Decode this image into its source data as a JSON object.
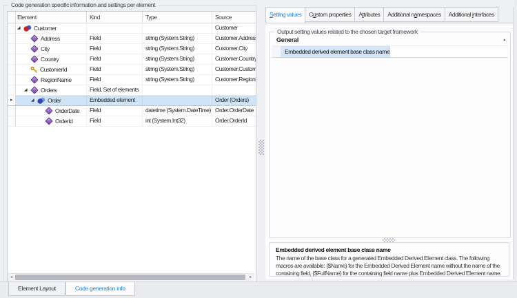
{
  "colors": {
    "accent_blue": "#1b87da",
    "selection_blue": "#cfe4f7",
    "window_background": "#eef0f3",
    "field_icon_purple": "#8952b5",
    "key_icon_gold": "#d4a500",
    "entity_icon_red": "#cf2020",
    "entity_icon_blue": "#3a57c4"
  },
  "icons": {
    "expander_expanded": "triangle-lower-right",
    "row_marker": "small-right-triangle",
    "category_collapse": "small-up-triangle",
    "scroll_left_arrow": "left-triangle",
    "scroll_right_arrow": "right-triangle",
    "field_icon": "purple-diamond",
    "primary_key_icon": "gold-key",
    "entity_icon": "red-blue-spheres",
    "embedded_element_icon": "blue-spheres"
  },
  "left_panel": {
    "group_title": "Code generation specific information and settings per element",
    "grid": {
      "columns": {
        "element": "Element",
        "kind": "Kind",
        "type": "Type",
        "source": "Source"
      },
      "rows": [
        {
          "label": "Customer",
          "kind": "",
          "type": "",
          "source": "Customer"
        },
        {
          "label": "Address",
          "kind": "Field",
          "type": "string (System.String)",
          "source": "Customer.Address"
        },
        {
          "label": "City",
          "kind": "Field",
          "type": "string (System.String)",
          "source": "Customer.City"
        },
        {
          "label": "Country",
          "kind": "Field",
          "type": "string (System.String)",
          "source": "Customer.Country"
        },
        {
          "label": "CustomerId",
          "kind": "Field",
          "type": "string (System.String)",
          "source": "Customer.CustomerId"
        },
        {
          "label": "RegionName",
          "kind": "Field",
          "type": "string (System.String)",
          "source": "Customer.RegionName"
        },
        {
          "label": "Orders",
          "kind": "Field, Set of elements",
          "type": "",
          "source": ""
        },
        {
          "label": "Order",
          "kind": "Embedded element",
          "type": "",
          "source": "Order (Orders)"
        },
        {
          "label": "OrderDate",
          "kind": "Field",
          "type": "datetime (System.DateTime)",
          "source": "Order.OrderDate"
        },
        {
          "label": "OrderId",
          "kind": "Field",
          "type": "int (System.Int32)",
          "source": "Order.OrderId"
        }
      ]
    }
  },
  "right_panel": {
    "tabs": [
      {
        "label": "Setting values",
        "underline": 0,
        "active": true
      },
      {
        "label": "Custom properties",
        "underline": 1,
        "active": false
      },
      {
        "label": "Attributes",
        "underline": 1,
        "active": false
      },
      {
        "label": "Additional namespaces",
        "underline": 12,
        "active": false
      },
      {
        "label": "Additional interfaces",
        "underline": 11,
        "active": false
      }
    ],
    "group_title": "Output setting values related to the chosen target framework",
    "category": "General",
    "property": {
      "label": "Embedded derived element base class name",
      "value": ""
    },
    "description": {
      "title": "Embedded derived element base class name",
      "body": "The name of the base class for a generated Embedded Derived Element class. The following macros are available: {$Name} for the Embedded Derived Element name without the name of the containing field, {$FullName} for the containing field name plus Embedded Derived Element name."
    }
  },
  "bottom_tabs": [
    {
      "label": "Element Layout",
      "active": false
    },
    {
      "label": "Code generation info",
      "active": true
    }
  ]
}
